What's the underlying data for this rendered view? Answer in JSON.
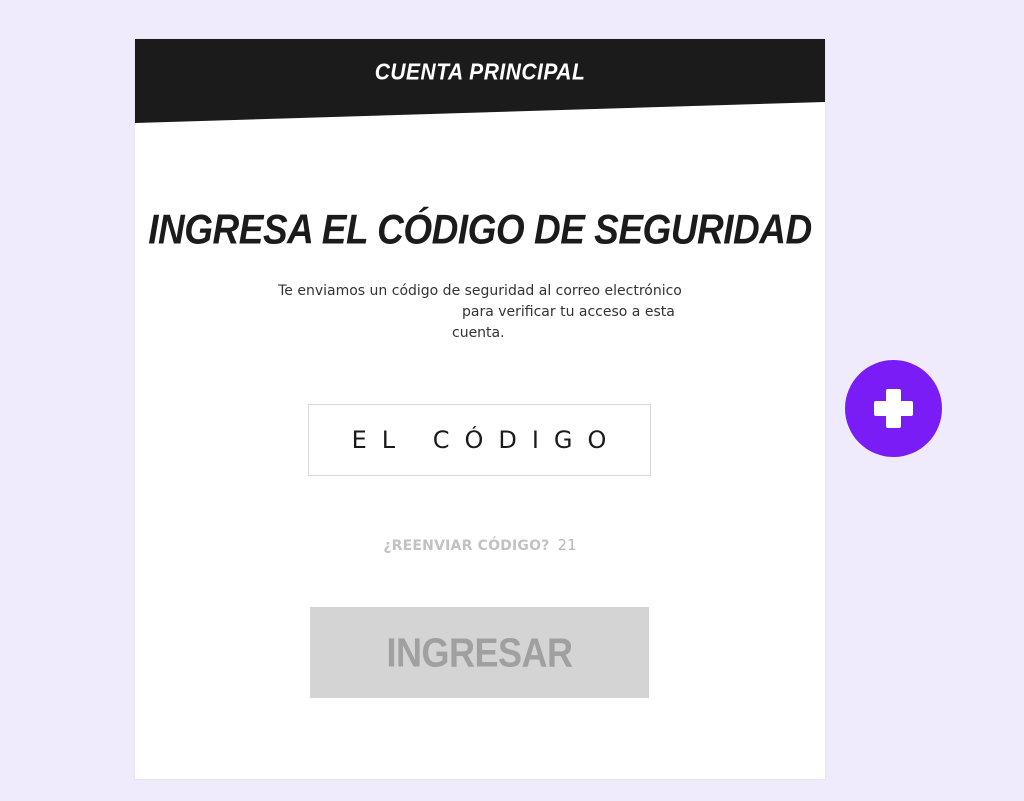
{
  "header": {
    "title": "CUENTA PRINCIPAL"
  },
  "main": {
    "title": "INGRESA EL CÓDIGO DE SEGURIDAD",
    "description": {
      "line1": "Te enviamos un código de seguridad al correo electrónico",
      "line2": "para verificar tu acceso a esta",
      "line3": "cuenta."
    },
    "code_input": {
      "value": "",
      "placeholder": "EL CÓDIGO"
    },
    "resend": {
      "label": "¿REENVIAR CÓDIGO?",
      "countdown": "21"
    },
    "submit_button": {
      "label": "INGRESAR"
    }
  },
  "fab": {
    "icon": "plus-icon"
  },
  "colors": {
    "page_background": "#efebfc",
    "header_band": "#1b1b1b",
    "accent": "#7a1cf6",
    "button_disabled": "#d4d4d4"
  }
}
